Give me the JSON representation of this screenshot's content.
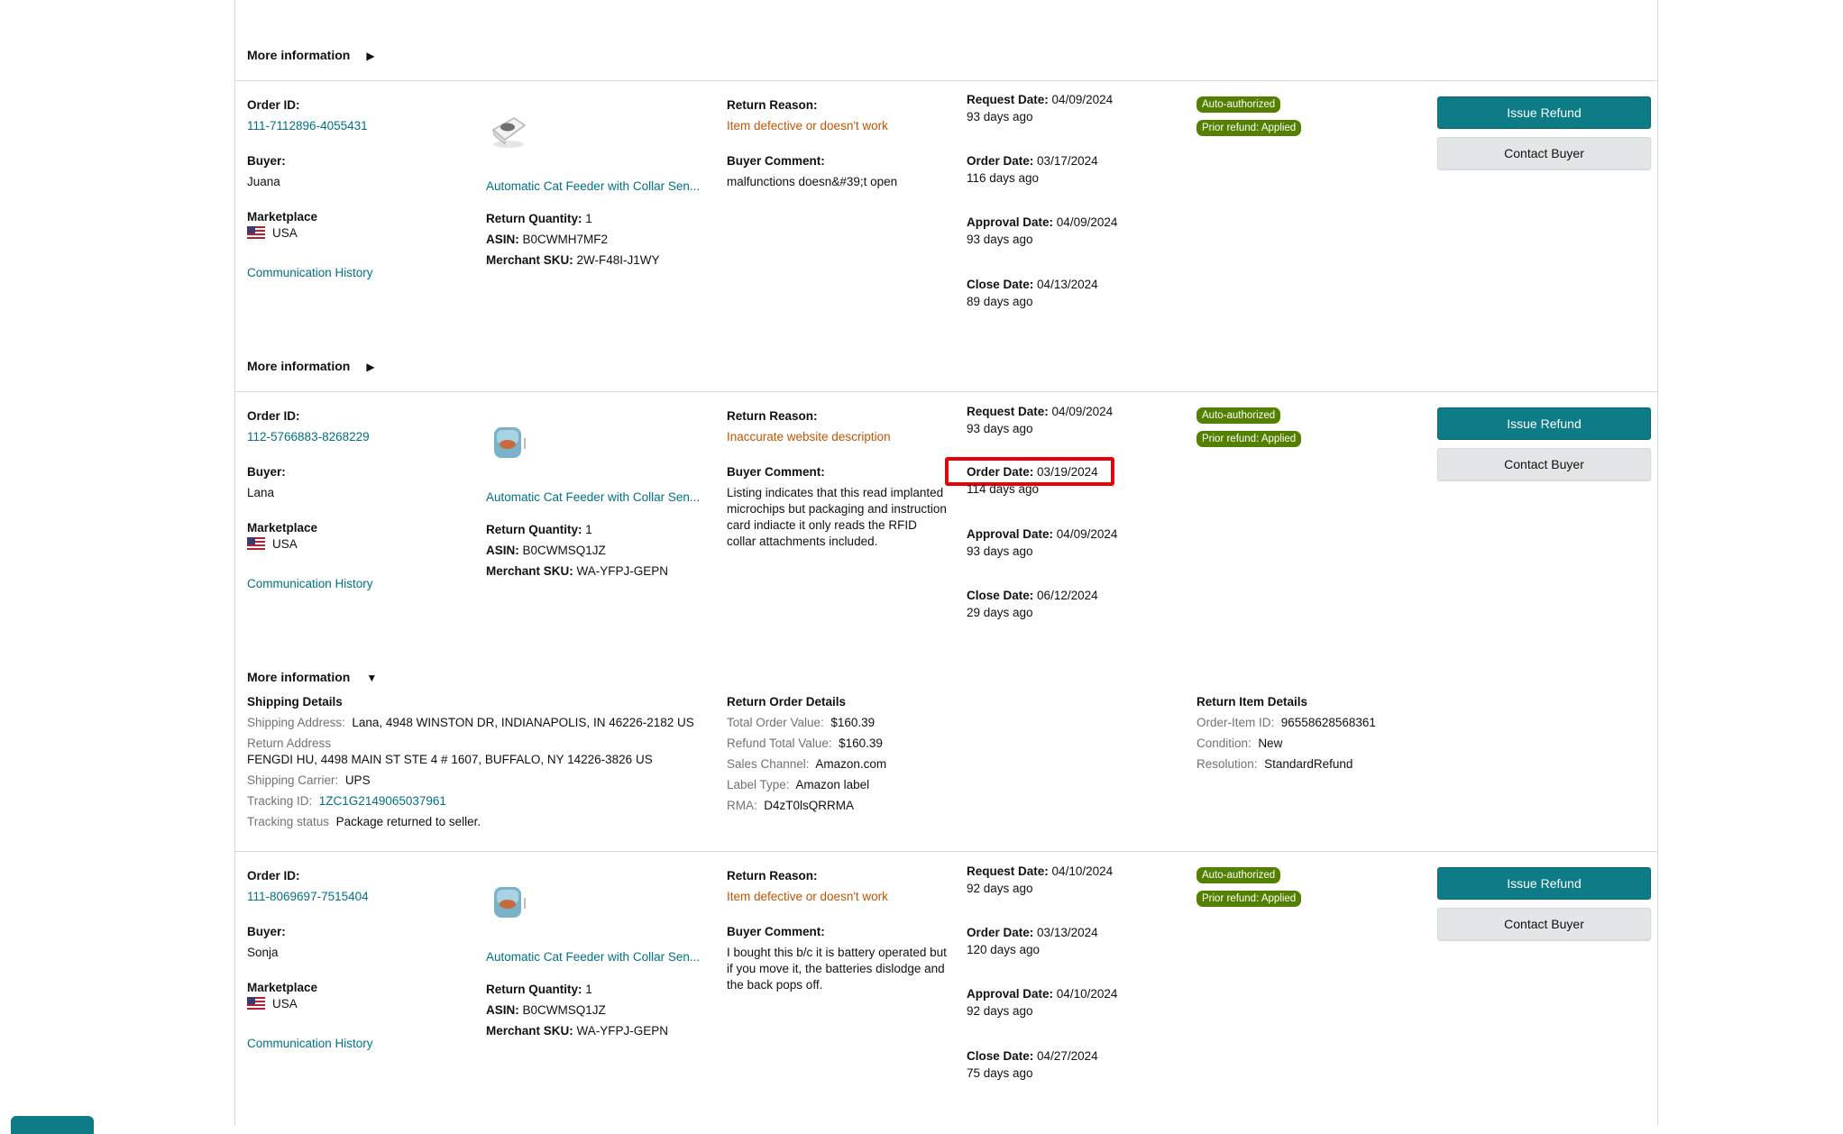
{
  "labels": {
    "more_information": "More information",
    "order_id": "Order ID:",
    "buyer": "Buyer:",
    "marketplace": "Marketplace",
    "communication_history": "Communication History",
    "return_quantity": "Return Quantity:",
    "asin": "ASIN:",
    "merchant_sku": "Merchant SKU:",
    "return_reason": "Return Reason:",
    "buyer_comment": "Buyer Comment:",
    "request_date": "Request Date:",
    "order_date": "Order Date:",
    "approval_date": "Approval Date:",
    "close_date": "Close Date:",
    "issue_refund": "Issue Refund",
    "contact_buyer": "Contact Buyer"
  },
  "icons": {
    "collapsed": "triangle-right-icon",
    "expanded": "triangle-down-icon",
    "flag": "us-flag-icon"
  },
  "colors": {
    "accent": "#0e7c86",
    "link": "#007185",
    "warning": "#c45500",
    "badge": "#538000",
    "highlight": "#e8000b"
  },
  "returns": [
    {
      "order_id": "111-7112896-4055431",
      "buyer": "Juana",
      "marketplace": "USA",
      "product_title": "Automatic Cat Feeder with Collar Sen...",
      "return_quantity": "1",
      "asin": "B0CWMH7MF2",
      "merchant_sku": "2W-F48I-J1WY",
      "return_reason": "Item defective or doesn't work",
      "buyer_comment": "malfunctions doesn&#39;t open",
      "request_date": "04/09/2024",
      "request_ago": "93 days ago",
      "order_date": "03/17/2024",
      "order_ago": "116 days ago",
      "approval_date": "04/09/2024",
      "approval_ago": "93 days ago",
      "close_date": "04/13/2024",
      "close_ago": "89 days ago",
      "badges": [
        "Auto-authorized",
        "Prior refund: Applied"
      ]
    },
    {
      "order_id": "112-5766883-8268229",
      "buyer": "Lana",
      "marketplace": "USA",
      "product_title": "Automatic Cat Feeder with Collar Sen...",
      "return_quantity": "1",
      "asin": "B0CWMSQ1JZ",
      "merchant_sku": "WA-YFPJ-GEPN",
      "return_reason": "Inaccurate website description",
      "buyer_comment": "Listing indicates that this read implanted microchips but packaging and instruction card indiacte it only reads the RFID collar attachments included.",
      "request_date": "04/09/2024",
      "request_ago": "93 days ago",
      "order_date": "03/19/2024",
      "order_ago": "114 days ago",
      "approval_date": "04/09/2024",
      "approval_ago": "93 days ago",
      "close_date": "06/12/2024",
      "close_ago": "29 days ago",
      "badges": [
        "Auto-authorized",
        "Prior refund: Applied"
      ]
    },
    {
      "order_id": "111-8069697-7515404",
      "buyer": "Sonja",
      "marketplace": "USA",
      "product_title": "Automatic Cat Feeder with Collar Sen...",
      "return_quantity": "1",
      "asin": "B0CWMSQ1JZ",
      "merchant_sku": "WA-YFPJ-GEPN",
      "return_reason": "Item defective or doesn't work",
      "buyer_comment": "I bought this b/c it is battery operated but if you move it, the batteries dislodge and the back pops off.",
      "request_date": "04/10/2024",
      "request_ago": "92 days ago",
      "order_date": "03/13/2024",
      "order_ago": "120 days ago",
      "approval_date": "04/10/2024",
      "approval_ago": "92 days ago",
      "close_date": "04/27/2024",
      "close_ago": "75 days ago",
      "badges": [
        "Auto-authorized",
        "Prior refund: Applied"
      ]
    }
  ],
  "details": {
    "shipping": {
      "title": "Shipping Details",
      "address_label": "Shipping Address:",
      "address": "Lana, 4948 WINSTON DR, INDIANAPOLIS, IN 46226-2182 US",
      "return_address_label": "Return Address",
      "return_address": "FENGDI HU, 4498 MAIN ST STE 4 # 1607, BUFFALO, NY 14226-3826 US",
      "carrier_label": "Shipping Carrier:",
      "carrier": "UPS",
      "tracking_label": "Tracking ID:",
      "tracking_id": "1ZC1G2149065037961",
      "status_label": "Tracking status",
      "status": "Package returned to seller."
    },
    "order": {
      "title": "Return Order Details",
      "total_label": "Total Order Value:",
      "total": "$160.39",
      "refund_label": "Refund Total Value:",
      "refund": "$160.39",
      "channel_label": "Sales Channel:",
      "channel": "Amazon.com",
      "label_type_label": "Label Type:",
      "label_type": "Amazon label",
      "rma_label": "RMA:",
      "rma": "D4zT0lsQRRMA"
    },
    "item": {
      "title": "Return Item Details",
      "order_item_label": "Order-Item ID:",
      "order_item_id": "96558628568361",
      "condition_label": "Condition:",
      "condition": "New",
      "resolution_label": "Resolution:",
      "resolution": "StandardRefund"
    }
  }
}
